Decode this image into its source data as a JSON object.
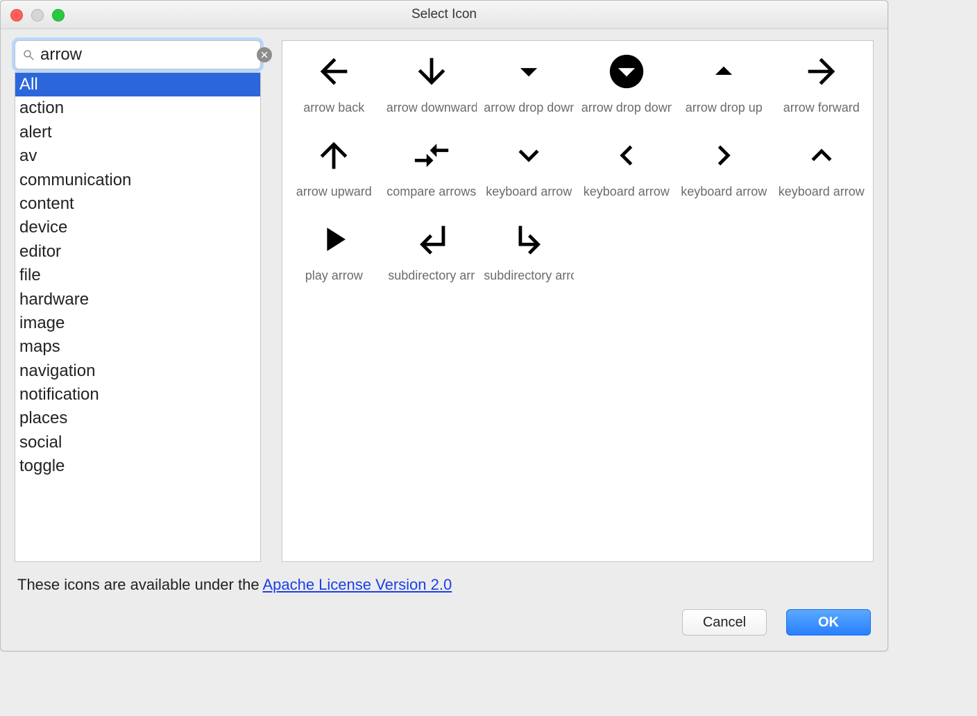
{
  "window": {
    "title": "Select Icon"
  },
  "search": {
    "value": "arrow"
  },
  "categories": [
    "All",
    "action",
    "alert",
    "av",
    "communication",
    "content",
    "device",
    "editor",
    "file",
    "hardware",
    "image",
    "maps",
    "navigation",
    "notification",
    "places",
    "social",
    "toggle"
  ],
  "categories_selected_index": 0,
  "icons": [
    {
      "id": "arrow-back-icon",
      "label": "arrow back"
    },
    {
      "id": "arrow-downward-icon",
      "label": "arrow downward"
    },
    {
      "id": "arrow-drop-down-icon",
      "label": "arrow drop down"
    },
    {
      "id": "arrow-drop-down-circle-icon",
      "label": "arrow drop down"
    },
    {
      "id": "arrow-drop-up-icon",
      "label": "arrow drop up"
    },
    {
      "id": "arrow-forward-icon",
      "label": "arrow forward"
    },
    {
      "id": "arrow-upward-icon",
      "label": "arrow upward"
    },
    {
      "id": "compare-arrows-icon",
      "label": "compare arrows"
    },
    {
      "id": "keyboard-arrow-down-icon",
      "label": "keyboard arrow "
    },
    {
      "id": "keyboard-arrow-left-icon",
      "label": "keyboard arrow "
    },
    {
      "id": "keyboard-arrow-right-icon",
      "label": "keyboard arrow "
    },
    {
      "id": "keyboard-arrow-up-icon",
      "label": "keyboard arrow "
    },
    {
      "id": "play-arrow-icon",
      "label": "play arrow"
    },
    {
      "id": "subdirectory-arrow-left-icon",
      "label": "subdirectory arr"
    },
    {
      "id": "subdirectory-arrow-right-icon",
      "label": "subdirectory arro"
    }
  ],
  "footer": {
    "intro": "These icons are available under the ",
    "link_text": "Apache License Version 2.0"
  },
  "buttons": {
    "cancel": "Cancel",
    "ok": "OK"
  }
}
